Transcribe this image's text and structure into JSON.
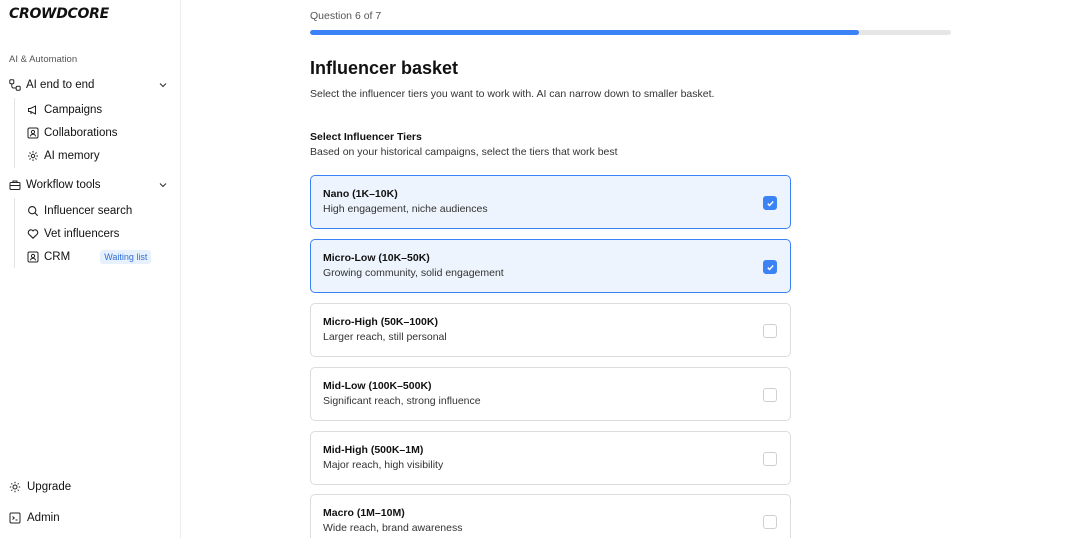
{
  "brand": {
    "logo_text": "CROWDCORE"
  },
  "sidebar": {
    "section_label": "AI & Automation",
    "groups": [
      {
        "label": "AI end to end",
        "icon": "workflow-icon",
        "items": [
          {
            "label": "Campaigns",
            "icon": "megaphone-icon"
          },
          {
            "label": "Collaborations",
            "icon": "contact-card-icon"
          },
          {
            "label": "AI memory",
            "icon": "gear-icon"
          }
        ]
      },
      {
        "label": "Workflow tools",
        "icon": "toolbox-icon",
        "items": [
          {
            "label": "Influencer search",
            "icon": "search-icon"
          },
          {
            "label": "Vet influencers",
            "icon": "heart-icon"
          },
          {
            "label": "CRM",
            "icon": "contact-card-icon",
            "badge": "Waiting list"
          }
        ]
      }
    ],
    "bottom": [
      {
        "label": "Upgrade",
        "icon": "sun-icon"
      },
      {
        "label": "Admin",
        "icon": "admin-panel-icon"
      }
    ]
  },
  "main": {
    "question_counter": "Question 6 of 7",
    "progress_fraction": 0.857,
    "title": "Influencer basket",
    "subtitle": "Select the influencer tiers you want to work with. AI can narrow down to smaller basket.",
    "section_title": "Select Influencer Tiers",
    "section_desc": "Based on your historical campaigns, select the tiers that work best",
    "tiers": [
      {
        "name": "Nano (1K–10K)",
        "desc": "High engagement, niche audiences",
        "selected": true
      },
      {
        "name": "Micro-Low (10K–50K)",
        "desc": "Growing community, solid engagement",
        "selected": true
      },
      {
        "name": "Micro-High (50K–100K)",
        "desc": "Larger reach, still personal",
        "selected": false
      },
      {
        "name": "Mid-Low (100K–500K)",
        "desc": "Significant reach, strong influence",
        "selected": false
      },
      {
        "name": "Mid-High (500K–1M)",
        "desc": "Major reach, high visibility",
        "selected": false
      },
      {
        "name": "Macro (1M–10M)",
        "desc": "Wide reach, brand awareness",
        "selected": false
      }
    ]
  },
  "colors": {
    "accent": "#3b82f6",
    "selected_bg": "#eef4fd",
    "badge_text": "#2f6fd6",
    "badge_bg": "#e7f0fd",
    "progress_track": "#e6e6e6"
  }
}
